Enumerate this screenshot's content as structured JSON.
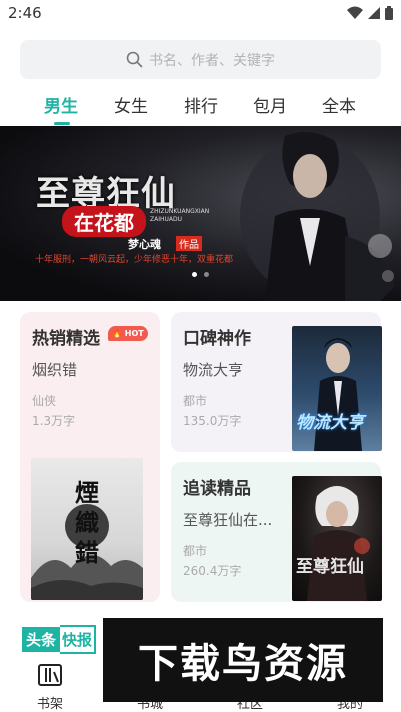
{
  "status_bar": {
    "time": "2:46"
  },
  "search": {
    "placeholder": "书名、作者、关键字"
  },
  "tabs": [
    {
      "label": "男生",
      "active": true
    },
    {
      "label": "女生"
    },
    {
      "label": "排行"
    },
    {
      "label": "包月"
    },
    {
      "label": "全本"
    }
  ],
  "banner": {
    "title": "至尊狂仙",
    "subtitle": "在花都",
    "english_line": "ZHIZUNKUANGXIAN ZAIHUADU",
    "author": "梦心魂",
    "author_tag": "作品",
    "tagline": "十年服刑，一朝风云起，少年修恶十年，双重花都"
  },
  "cards": {
    "hot": {
      "title": "热销精选",
      "badge": "HOT",
      "book": "烟织错",
      "genre": "仙侠",
      "words": "1.3万字",
      "cover_text": "煙織錯"
    },
    "koubei": {
      "title": "口碑神作",
      "book": "物流大亨",
      "genre": "都市",
      "words": "135.0万字",
      "cover_text": "物流大亨"
    },
    "zhuidu": {
      "title": "追读精品",
      "book": "至尊狂仙在...",
      "genre": "都市",
      "words": "260.4万字",
      "cover_text": "至尊狂仙"
    }
  },
  "news": {
    "part_a": "头条",
    "part_b": "快报"
  },
  "bottom_nav": [
    {
      "label": "书架"
    },
    {
      "label": "书城"
    },
    {
      "label": "社区"
    },
    {
      "label": "我的"
    }
  ],
  "watermark": {
    "text": "下载鸟资源"
  },
  "colors": {
    "accent": "#20b2a3",
    "hot": "#f25a4e"
  }
}
